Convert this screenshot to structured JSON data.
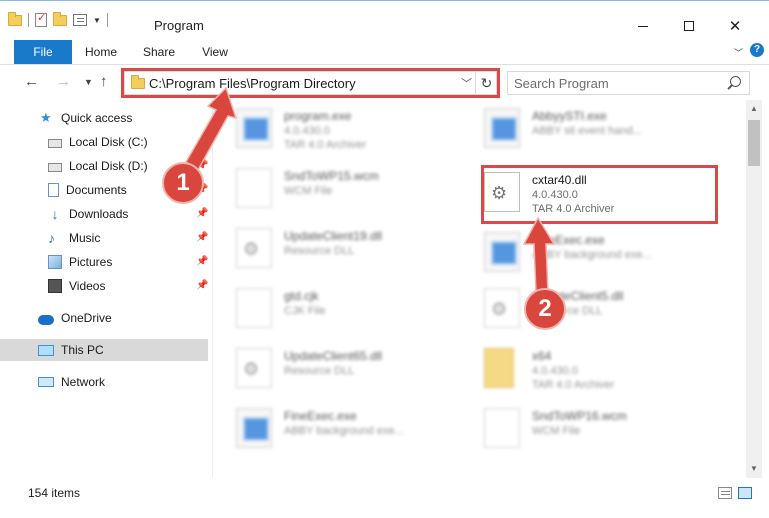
{
  "window": {
    "title": "Program"
  },
  "ribbon": {
    "tabs": [
      "File",
      "Home",
      "Share",
      "View"
    ]
  },
  "address_bar": {
    "path": "C:\\Program Files\\Program Directory"
  },
  "search": {
    "placeholder": "Search Program"
  },
  "sidebar": {
    "items": [
      {
        "label": "Quick access",
        "icon": "star-icon"
      },
      {
        "label": "Local Disk (C:)",
        "icon": "drive-icon"
      },
      {
        "label": "Local Disk (D:)",
        "icon": "drive-icon"
      },
      {
        "label": "Documents",
        "icon": "documents-icon"
      },
      {
        "label": "Downloads",
        "icon": "download-icon"
      },
      {
        "label": "Music",
        "icon": "music-icon"
      },
      {
        "label": "Pictures",
        "icon": "pictures-icon"
      },
      {
        "label": "Videos",
        "icon": "videos-icon"
      },
      {
        "label": "OneDrive",
        "icon": "cloud-icon"
      },
      {
        "label": "This PC",
        "icon": "computer-icon"
      },
      {
        "label": "Network",
        "icon": "network-icon"
      }
    ],
    "selected": "This PC"
  },
  "files": [
    {
      "name": "program.exe",
      "line1": "4.0.430.0",
      "line2": "TAR 4.0 Archiver",
      "icon": "exe-icon"
    },
    {
      "name": "AbbyySTI.exe",
      "line1": "ABBY sti event hand...",
      "line2": "",
      "icon": "exe-icon"
    },
    {
      "name": "SndToWP15.wcm",
      "line1": "WCM File",
      "line2": "",
      "icon": "file-icon"
    },
    {
      "name": "cxtar40.dll",
      "line1": "4.0.430.0",
      "line2": "TAR 4.0 Archiver",
      "icon": "dll-icon"
    },
    {
      "name": "UpdateClient19.dll",
      "line1": "Resource DLL",
      "line2": "",
      "icon": "dll-icon"
    },
    {
      "name": "FineExec.exe",
      "line1": "ABBY background exe...",
      "line2": "",
      "icon": "exe-icon"
    },
    {
      "name": "gtd.cjk",
      "line1": "CJK File",
      "line2": "",
      "icon": "file-icon"
    },
    {
      "name": "UpdateClient5.dll",
      "line1": "Resource DLL",
      "line2": "",
      "icon": "dll-icon"
    },
    {
      "name": "UpdateClient65.dll",
      "line1": "Resource DLL",
      "line2": "",
      "icon": "dll-icon"
    },
    {
      "name": "x64",
      "line1": "4.0.430.0",
      "line2": "TAR 4.0 Archiver",
      "icon": "folder-icon"
    },
    {
      "name": "FineExec.exe",
      "line1": "ABBY background exe...",
      "line2": "",
      "icon": "exe-icon"
    },
    {
      "name": "SndToWP16.wcm",
      "line1": "WCM File",
      "line2": "",
      "icon": "file-icon"
    }
  ],
  "annotations": {
    "step1": "1",
    "step2": "2",
    "color": "#d84a4a"
  },
  "statusbar": {
    "item_count": "154 items"
  }
}
